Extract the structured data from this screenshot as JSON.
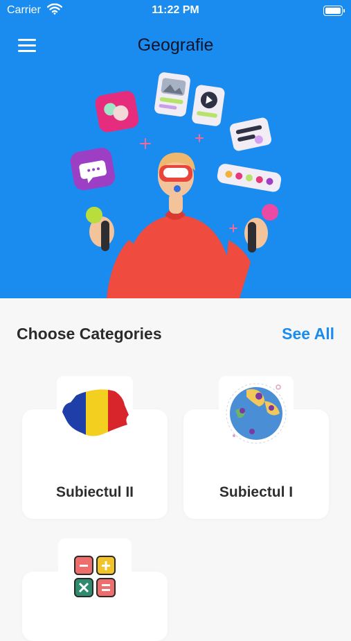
{
  "status_bar": {
    "carrier": "Carrier",
    "time": "11:22 PM"
  },
  "header": {
    "title": "Geografie",
    "menu_icon": "hamburger-menu-icon"
  },
  "section": {
    "title": "Choose Categories",
    "see_all": "See All"
  },
  "categories": [
    {
      "label": "Subiectul II",
      "icon": "romania-flag-map-icon"
    },
    {
      "label": "Subiectul I",
      "icon": "globe-map-pins-icon"
    },
    {
      "label": "",
      "icon": "calculator-operations-icon"
    }
  ],
  "colors": {
    "hero": "#1a8cf0",
    "accent": "#1a8cf0",
    "background": "#f7f7f8",
    "card": "#ffffff"
  }
}
